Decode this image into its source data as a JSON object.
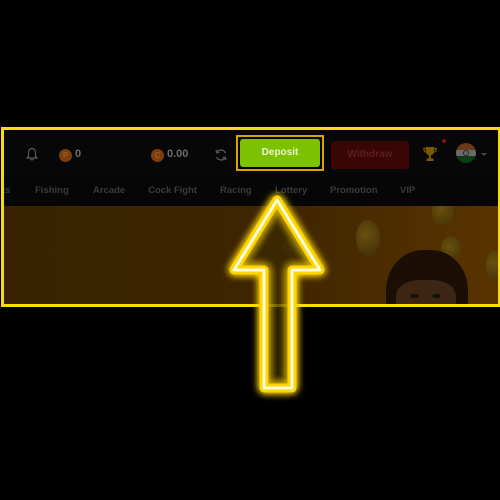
{
  "header": {
    "points_balance": "0",
    "cash_balance": "0.00",
    "points_coin_letter": "P",
    "cash_coin_letter": "C",
    "deposit_label": "Deposit",
    "withdraw_label": "Withdraw",
    "language_flag": "India"
  },
  "icons": {
    "notification": "bell-icon",
    "refresh": "refresh-icon",
    "trophy": "trophy-icon",
    "language": "india-flag-icon",
    "dropdown": "chevron-down-icon",
    "pointer": "arrow-up-icon"
  },
  "nav": {
    "items": [
      {
        "label": "ts"
      },
      {
        "label": "Fishing"
      },
      {
        "label": "Arcade"
      },
      {
        "label": "Cock Fight"
      },
      {
        "label": "Racing"
      },
      {
        "label": "Lottery"
      },
      {
        "label": "Promotion"
      },
      {
        "label": "VIP"
      }
    ]
  },
  "colors": {
    "highlight_frame": "#f5dc0a",
    "deposit": "#7dc200",
    "withdraw": "#3a0505",
    "arrow_glow": "#ffe600"
  }
}
